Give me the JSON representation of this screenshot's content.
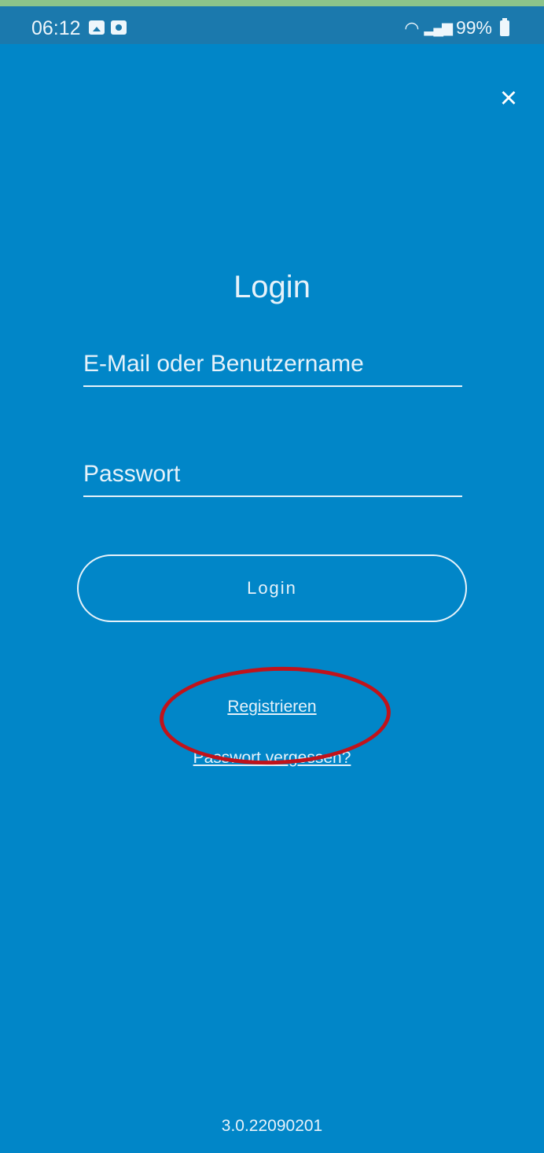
{
  "status_bar": {
    "time": "06:12",
    "battery": "99%",
    "icons": [
      "photo-icon",
      "screen-record-icon",
      "wifi-icon",
      "signal-icon",
      "battery-icon"
    ]
  },
  "header": {
    "close_icon": "×"
  },
  "login": {
    "title": "Login",
    "email_placeholder": "E-Mail oder Benutzername",
    "password_placeholder": "Passwort",
    "login_button": "Login",
    "register_link": "Registrieren",
    "forgot_password_link": "Passwort vergessen?"
  },
  "footer": {
    "version": "3.0.22090201"
  },
  "colors": {
    "background": "#0186c8",
    "status_bar": "#1b79ad",
    "highlight": "#c0131b",
    "text": "#e6f2fa"
  }
}
